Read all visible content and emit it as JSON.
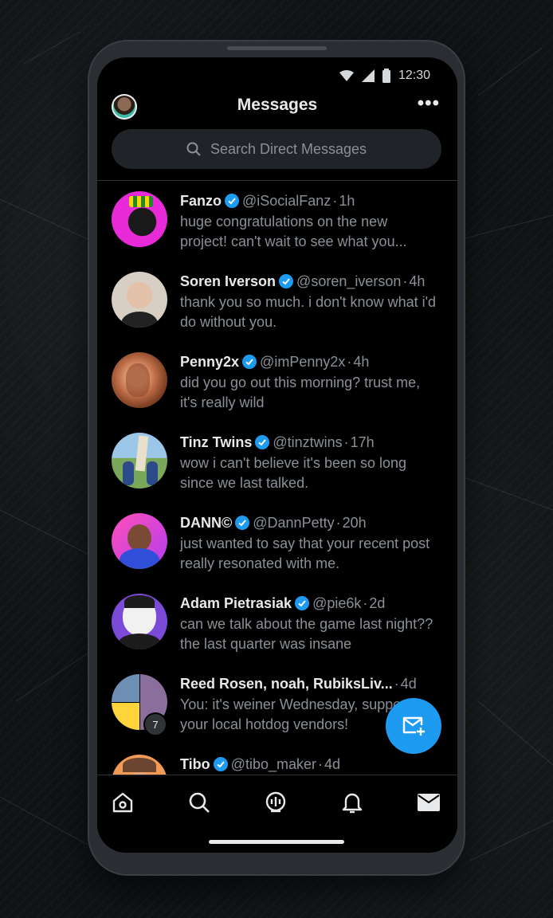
{
  "status_bar": {
    "time": "12:30"
  },
  "header": {
    "title": "Messages",
    "more_label": "•••"
  },
  "search": {
    "placeholder": "Search Direct Messages"
  },
  "conversations": [
    {
      "name": "Fanzo",
      "verified": true,
      "handle": "@iSocialFanz",
      "time": "1h",
      "message": "huge congratulations on the new project! can't wait to see what you..."
    },
    {
      "name": "Soren Iverson",
      "verified": true,
      "handle": "@soren_iverson",
      "time": "4h",
      "message": "thank you so much. i don't know what i'd do without you."
    },
    {
      "name": "Penny2x",
      "verified": true,
      "handle": "@imPenny2x",
      "time": "4h",
      "message": "did you go out this morning? trust me, it's really wild"
    },
    {
      "name": "Tinz Twins",
      "verified": true,
      "handle": "@tinztwins",
      "time": "17h",
      "message": "wow i can't believe it's been so long since we last talked."
    },
    {
      "name": "DANN©",
      "verified": true,
      "handle": "@DannPetty",
      "time": "20h",
      "message": "just wanted to say that your recent post really resonated with me."
    },
    {
      "name": "Adam Pietrasiak",
      "verified": true,
      "handle": "@pie6k",
      "time": "2d",
      "message": "can we talk about the game last night?? the last quarter was insane"
    },
    {
      "name": "Reed Rosen, noah, RubiksLiv...",
      "verified": false,
      "handle": "",
      "time": "4d",
      "message": "You: it's weiner Wednesday, support your local hotdog vendors!",
      "group_count": "7"
    },
    {
      "name": "Tibo",
      "verified": true,
      "handle": "@tibo_maker",
      "time": "4d",
      "message": ""
    }
  ],
  "nav": [
    "home-icon",
    "search-icon",
    "spaces-icon",
    "notifications-icon",
    "messages-icon"
  ],
  "colors": {
    "accent": "#1d9bf0",
    "background": "#000000",
    "secondary_text": "#8b9097"
  }
}
